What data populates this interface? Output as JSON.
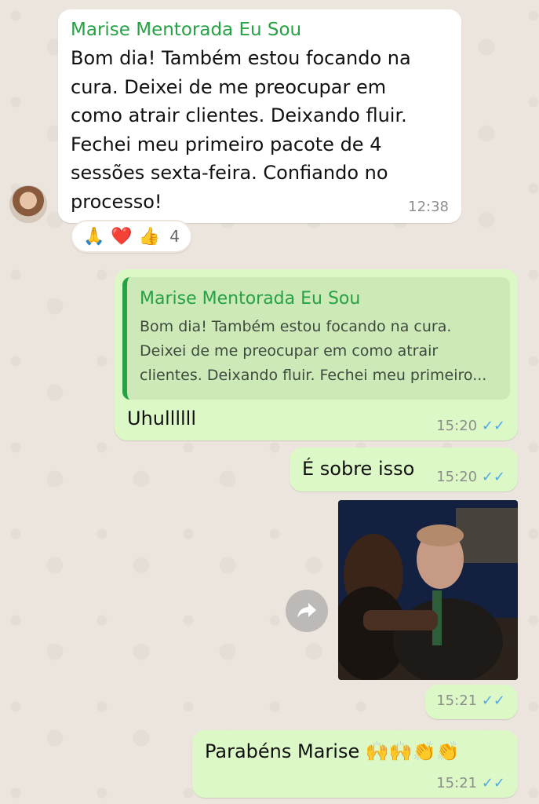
{
  "messages": {
    "m1": {
      "sender": "Marise Mentorada Eu Sou",
      "lines": [
        "Bom dia! Também estou focando na",
        "cura. Deixei de me preocupar em",
        "como atrair clientes. Deixando fluir.",
        "Fechei meu primeiro pacote de 4",
        "sessões sexta-feira. Confiando no",
        "processo!"
      ],
      "time": "12:38",
      "reactions": {
        "emojis": [
          "🙏",
          "❤️",
          "👍"
        ],
        "count": "4"
      }
    },
    "m2": {
      "quote_sender": "Marise Mentorada Eu Sou",
      "quote_lines": [
        "Bom dia! Também estou focando na cura.",
        "Deixei de me preocupar em como atrair",
        "clientes. Deixando fluir. Fechei meu primeiro..."
      ],
      "text": "Uhullllll",
      "time": "15:20",
      "ticks": "✓✓"
    },
    "m3": {
      "text": "É sobre isso",
      "time": "15:20",
      "ticks": "✓✓"
    },
    "m4": {
      "time": "15:21",
      "ticks": "✓✓"
    },
    "m5": {
      "text": "Parabéns Marise",
      "emojis": "🙌🙌👏👏",
      "time": "15:21",
      "ticks": "✓✓"
    }
  },
  "icons": {
    "forward": "forward-arrow-icon",
    "read_receipt": "double-check-icon"
  },
  "colors": {
    "background": "#ece5dd",
    "incoming_bubble": "#ffffff",
    "outgoing_bubble": "#dcf8c6",
    "sender_name": "#25a244",
    "read_ticks": "#4fa9e8"
  }
}
